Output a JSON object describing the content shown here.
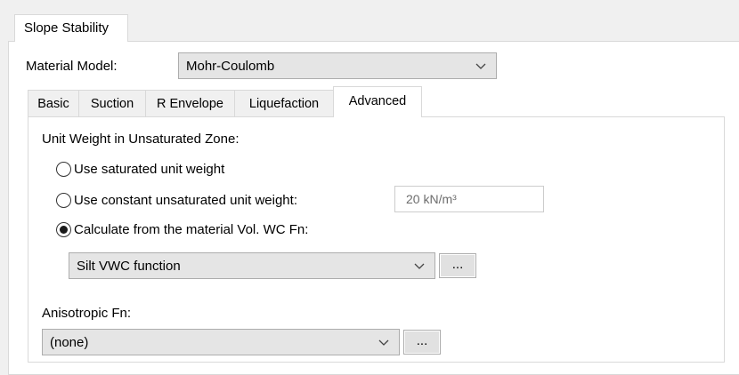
{
  "window": {
    "tab_label": "Slope Stability"
  },
  "material_model": {
    "label": "Material Model:",
    "value": "Mohr-Coulomb"
  },
  "inner_tabs": [
    {
      "label": "Basic",
      "active": false
    },
    {
      "label": "Suction",
      "active": false
    },
    {
      "label": "R Envelope",
      "active": false
    },
    {
      "label": "Liquefaction",
      "active": false
    },
    {
      "label": "Advanced",
      "active": true
    }
  ],
  "advanced": {
    "section_label": "Unit Weight in Unsaturated Zone:",
    "options": [
      {
        "label": "Use saturated unit weight",
        "selected": false
      },
      {
        "label": "Use constant unsaturated unit weight:",
        "selected": false
      },
      {
        "label": "Calculate from the material Vol. WC Fn:",
        "selected": true
      }
    ],
    "constant_weight_value": "20 kN/m³",
    "vwc_function": {
      "value": "Silt VWC function",
      "browse_label": "..."
    },
    "anisotropic_label": "Anisotropic Fn:",
    "anisotropic_function": {
      "value": "(none)",
      "browse_label": "..."
    }
  },
  "icons": {
    "dropdown": "chevron-down-icon",
    "radio_selected": "radio-selected-icon",
    "radio_unselected": "radio-unselected-icon"
  },
  "colors": {
    "panel_bg": "#ffffff",
    "window_bg": "#f0f0f0",
    "combo_bg": "#e5e5e5",
    "border": "#d9d9d9",
    "disabled_text": "#6d6d6d"
  }
}
